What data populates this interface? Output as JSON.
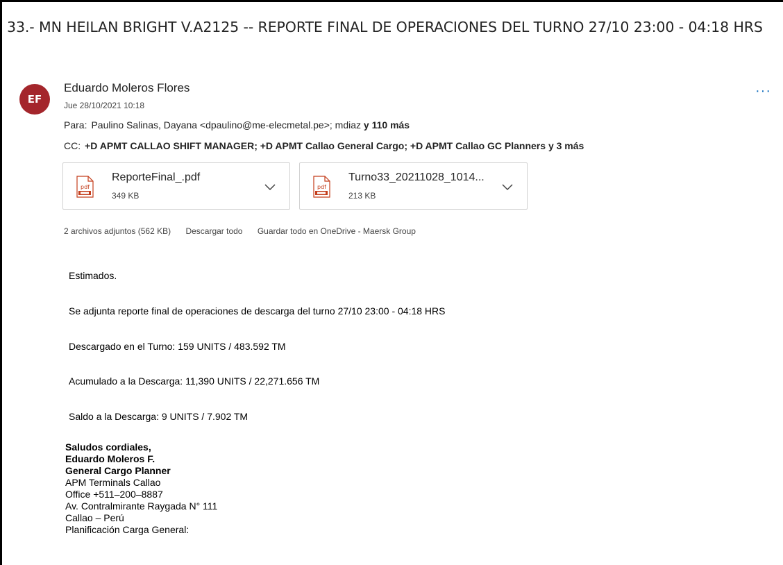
{
  "email": {
    "subject": "33.- MN HEILAN BRIGHT V.A2125 -- REPORTE FINAL DE OPERACIONES DEL TURNO 27/10 23:00 - 04:18 HRS",
    "avatar_initials": "EF",
    "avatar_color": "#a4262c",
    "sender": "Eduardo Moleros Flores",
    "date": "Jue 28/10/2021 10:18",
    "more_icon": "more-horizontal-icon",
    "to": {
      "label": "Para:",
      "recipients": "Paulino Salinas, Dayana <dpaulino@me-elecmetal.pe>; mdiaz",
      "more": "y 110 más"
    },
    "cc": {
      "label": "CC:",
      "recipients": "+D APMT CALLAO SHIFT MANAGER; +D APMT Callao General Cargo; +D APMT Callao GC Planners",
      "more": "y 3 más"
    },
    "attachments": [
      {
        "name": "ReporteFinal_.pdf",
        "size": "349 KB",
        "icon": "pdf-icon",
        "icon_label": "pdf"
      },
      {
        "name": "Turno33_20211028_1014...",
        "size": "213 KB",
        "icon": "pdf-icon",
        "icon_label": "pdf"
      }
    ],
    "attachment_summary": {
      "count": "2 archivos adjuntos (562 KB)",
      "download_all": "Descargar todo",
      "save_onedrive": "Guardar todo en OneDrive - Maersk Group"
    },
    "body": {
      "greeting": "Estimados.",
      "intro": "Se adjunta reporte final de operaciones de descarga del turno 27/10 23:00 - 04:18 HRS",
      "discharged": "Descargado en el Turno: 159 UNITS / 483.592 TM",
      "accumulated": "Acumulado a la Descarga: 11,390 UNITS / 22,271.656 TM",
      "balance": "Saldo a la Descarga: 9 UNITS / 7.902 TM"
    },
    "signature": {
      "closing": "Saludos cordiales,",
      "name": "Eduardo Moleros F.",
      "title": "General Cargo Planner",
      "company": "APM Terminals Callao",
      "office": "Office +511–200–8887",
      "address": "Av. Contralmirante Raygada N° 111",
      "city": "Callao – Perú",
      "dept": "Planificación Carga General:"
    },
    "colors": {
      "accent": "#0f6cbd",
      "pdf_red": "#c43e1c",
      "border": "#d1d1d1"
    }
  }
}
